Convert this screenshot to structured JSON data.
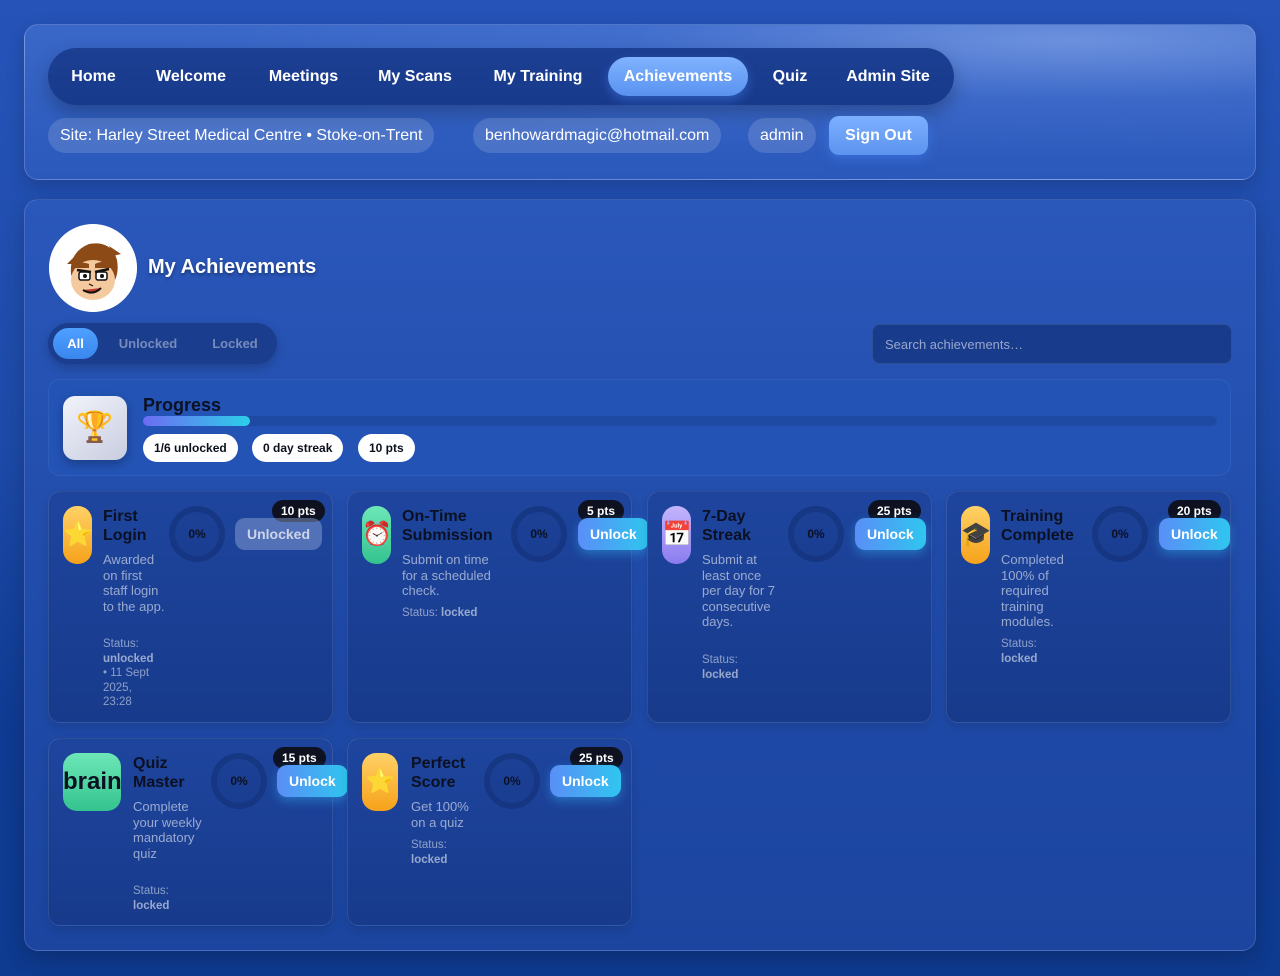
{
  "nav": {
    "items": [
      {
        "label": "Home"
      },
      {
        "label": "Welcome"
      },
      {
        "label": "Meetings"
      },
      {
        "label": "My Scans"
      },
      {
        "label": "My Training"
      },
      {
        "label": "Achievements"
      },
      {
        "label": "Quiz"
      },
      {
        "label": "Admin Site"
      }
    ],
    "active": "Achievements"
  },
  "user_bar": {
    "site": "Site: Harley Street Medical Centre • Stoke-on-Trent",
    "email": "benhowardmagic@hotmail.com",
    "role": "admin",
    "sign_out": "Sign Out"
  },
  "page": {
    "title": "My Achievements"
  },
  "filters": {
    "options": [
      "All",
      "Unlocked",
      "Locked"
    ],
    "selected": "All"
  },
  "search": {
    "placeholder": "Search achievements…"
  },
  "progress": {
    "title": "Progress",
    "fraction": 0.1,
    "unlocked_text": "1/6 unlocked",
    "streak_text": "0 day streak",
    "points_text": "10 pts"
  },
  "achievements": [
    {
      "icon": "star-icon",
      "glyph": "⭐",
      "title": "First Login",
      "description": "Awarded on first staff login to the app.",
      "status_label": "Status:",
      "status": "unlocked",
      "status_extra": "• 11 Sept 2025, 23:28",
      "progress": "0%",
      "points": "10 pts",
      "button": "Unlocked"
    },
    {
      "icon": "alarm-clock-icon",
      "glyph": "⏰",
      "title": "On-Time Submission",
      "description": "Submit on time for a scheduled check.",
      "status_label": "Status:",
      "status": "locked",
      "progress": "0%",
      "points": "5 pts",
      "button": "Unlock"
    },
    {
      "icon": "calendar-icon",
      "glyph": "📅",
      "title": "7-Day Streak",
      "description": "Submit at least once per day for 7 consecutive days.",
      "status_label": "Status:",
      "status": "locked",
      "progress": "0%",
      "points": "25 pts",
      "button": "Unlock"
    },
    {
      "icon": "graduation-cap-icon",
      "glyph": "🎓",
      "title": "Training Complete",
      "description": "Completed 100% of required training modules.",
      "status_label": "Status:",
      "status": "locked",
      "progress": "0%",
      "points": "20 pts",
      "button": "Unlock"
    },
    {
      "icon": "brain-icon",
      "glyph": "brain",
      "title": "Quiz Master",
      "description": "Complete your weekly mandatory quiz",
      "status_label": "Status:",
      "status": "locked",
      "progress": "0%",
      "points": "15 pts",
      "button": "Unlock"
    },
    {
      "icon": "star-icon",
      "glyph": "⭐",
      "title": "Perfect Score",
      "description": "Get 100% on a quiz",
      "status_label": "Status:",
      "status": "locked",
      "progress": "0%",
      "points": "25 pts",
      "button": "Unlock"
    }
  ],
  "colors": {
    "accent": "#5a92f0",
    "gradient_start": "#5a8ef7",
    "gradient_end": "#2fc6ef",
    "background": "#1d4aa8"
  }
}
